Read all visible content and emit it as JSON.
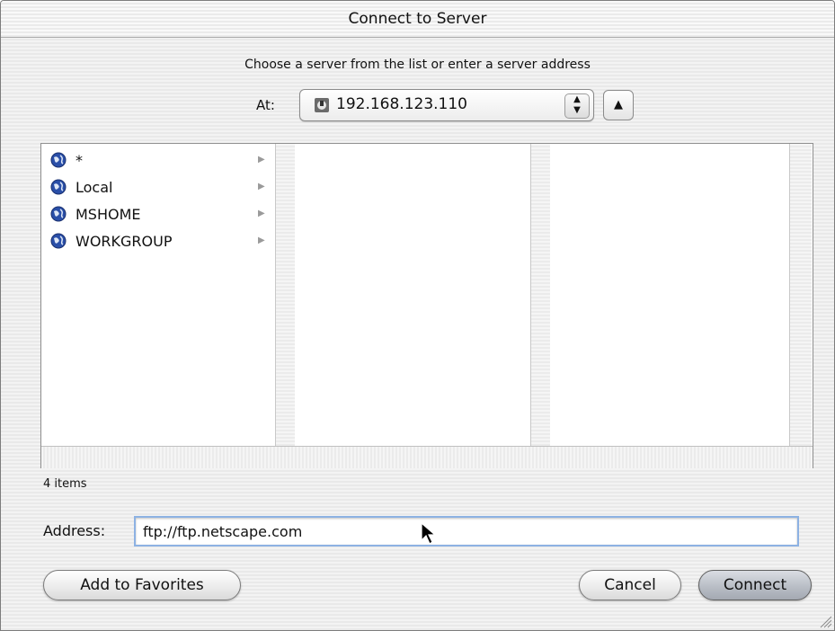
{
  "window": {
    "title": "Connect to Server"
  },
  "instruction": "Choose a server from the list or enter a server address",
  "location": {
    "label": "At:",
    "value": "192.168.123.110",
    "icon": "server-icon",
    "up_icon": "up-arrow-icon"
  },
  "browser": {
    "column1_items": [
      {
        "label": "*",
        "icon": "globe-icon"
      },
      {
        "label": "Local",
        "icon": "globe-icon"
      },
      {
        "label": "MSHOME",
        "icon": "globe-icon"
      },
      {
        "label": "WORKGROUP",
        "icon": "globe-icon"
      }
    ]
  },
  "status": {
    "count_text": "4 items"
  },
  "address": {
    "label": "Address:",
    "value": "ftp://ftp.netscape.com"
  },
  "buttons": {
    "add_favorites": "Add to Favorites",
    "cancel": "Cancel",
    "connect": "Connect"
  },
  "colors": {
    "focus_ring": "#8db2e3",
    "globe": "#2a4fa8"
  }
}
